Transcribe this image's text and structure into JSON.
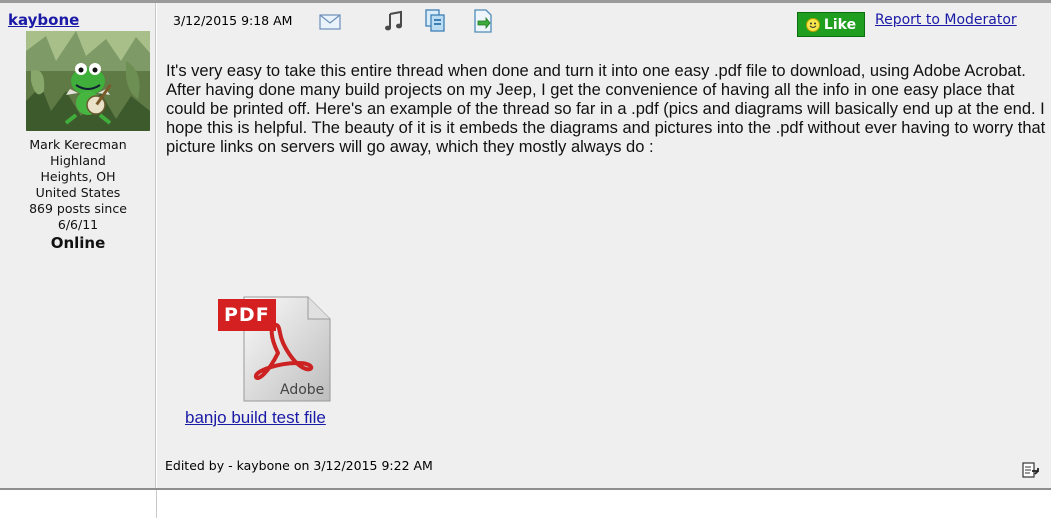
{
  "author": {
    "username": "kaybone",
    "real_name": "Mark Kerecman",
    "city": "Highland Heights, OH",
    "country": "United States",
    "posts_since": "869 posts since 6/6/11",
    "status": "Online"
  },
  "post": {
    "timestamp": "3/12/2015 9:18 AM",
    "like_label": "Like",
    "report_label": "Report to Moderator",
    "body": "It's very easy to take this entire thread when done and turn it into one easy .pdf file to download, using Adobe Acrobat.  After having done many build projects on my Jeep, I get the convenience of having all the info in one easy place that could be printed off. Here's an example of the thread so far in a .pdf (pics and diagrams will basically end up at the end. I hope this is helpful. The beauty of it is it embeds the diagrams and pictures into the .pdf without ever having to worry that picture links on servers will go away, which they mostly always do :",
    "attachment": {
      "icon_label": "PDF",
      "icon_brand": "Adobe",
      "link_text": "banjo build test file"
    },
    "edited_note": "Edited by - kaybone on 3/12/2015 9:22 AM"
  },
  "toolbar_icons": [
    "email-icon",
    "music-note-icon",
    "copy-icon",
    "forward-icon"
  ],
  "colors": {
    "link": "#1a1aa6",
    "like_green": "#1f9e1f",
    "background": "#efefef"
  }
}
